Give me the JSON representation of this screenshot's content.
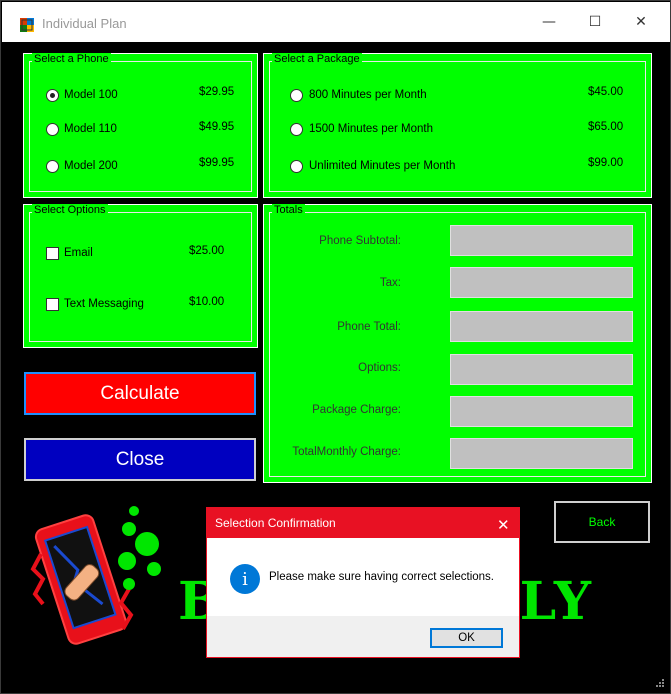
{
  "window": {
    "title": "Individual Plan",
    "minimize_glyph": "—",
    "maximize_glyph": "☐",
    "close_glyph": "✕"
  },
  "phone_group": {
    "title": "Select a Phone",
    "options": [
      {
        "label": "Model 100",
        "price": "$29.95",
        "selected": true
      },
      {
        "label": "Model 110",
        "price": "$49.95",
        "selected": false
      },
      {
        "label": "Model 200",
        "price": "$99.95",
        "selected": false
      }
    ]
  },
  "package_group": {
    "title": "Select a Package",
    "options": [
      {
        "label": "800 Minutes per Month",
        "price": "$45.00",
        "selected": false
      },
      {
        "label": "1500 Minutes per Month",
        "price": "$65.00",
        "selected": false
      },
      {
        "label": "Unlimited Minutes per Month",
        "price": "$99.00",
        "selected": false
      }
    ]
  },
  "options_group": {
    "title": "Select Options",
    "items": [
      {
        "label": "Email",
        "price": "$25.00",
        "checked": false
      },
      {
        "label": "Text Messaging",
        "price": "$10.00",
        "checked": false
      }
    ]
  },
  "totals_group": {
    "title": "Totals",
    "rows": [
      {
        "label": "Phone Subtotal:",
        "value": ""
      },
      {
        "label": "Tax:",
        "value": ""
      },
      {
        "label": "Phone Total:",
        "value": ""
      },
      {
        "label": "Options:",
        "value": ""
      },
      {
        "label": "Package Charge:",
        "value": ""
      },
      {
        "label": "TotalMonthly Charge:",
        "value": ""
      }
    ]
  },
  "buttons": {
    "calculate": "Calculate",
    "close": "Close",
    "back": "Back"
  },
  "banner": {
    "text_left": "B",
    "text_right": "ELY"
  },
  "dialog": {
    "title": "Selection Confirmation",
    "close_glyph": "✕",
    "icon_glyph": "i",
    "message": "Please make sure having correct selections.",
    "ok_label": "OK"
  },
  "colors": {
    "group_bg": "#00ff00",
    "calculate_bg": "#ff0000",
    "close_bg": "#0000c0",
    "dialog_accent": "#e81123",
    "info_icon": "#0078d7"
  }
}
